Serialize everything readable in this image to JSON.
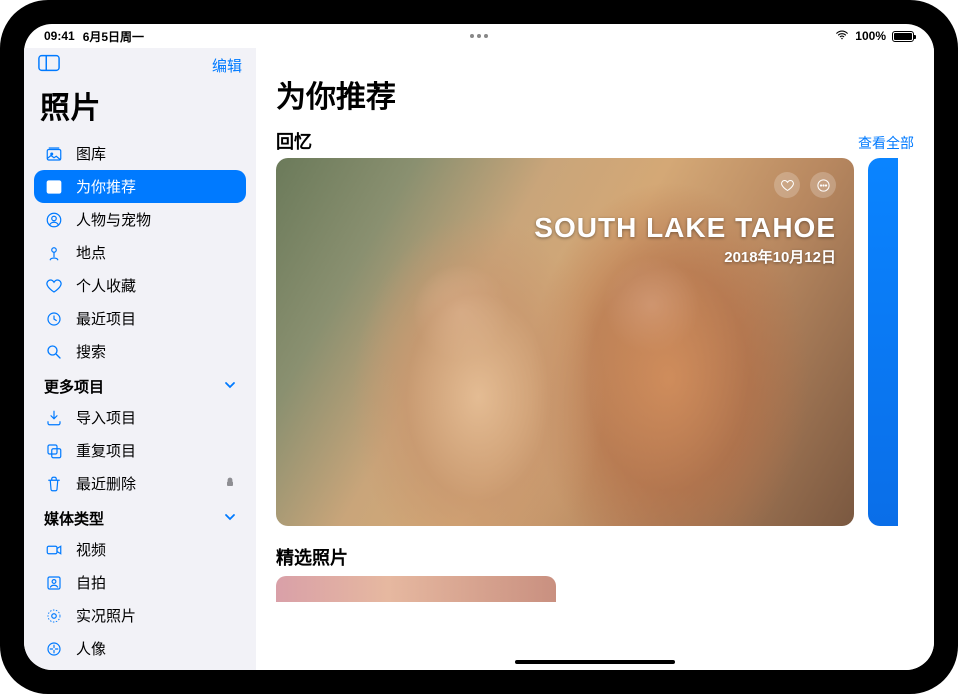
{
  "status": {
    "time": "09:41",
    "date": "6月5日周一",
    "battery_pct": "100%"
  },
  "sidebar": {
    "edit_label": "编辑",
    "title": "照片",
    "items": [
      {
        "label": "图库"
      },
      {
        "label": "为你推荐"
      },
      {
        "label": "人物与宠物"
      },
      {
        "label": "地点"
      },
      {
        "label": "个人收藏"
      },
      {
        "label": "最近项目"
      },
      {
        "label": "搜索"
      }
    ],
    "section_more": "更多项目",
    "more_items": [
      {
        "label": "导入项目"
      },
      {
        "label": "重复项目"
      },
      {
        "label": "最近删除"
      }
    ],
    "section_media": "媒体类型",
    "media_items": [
      {
        "label": "视频"
      },
      {
        "label": "自拍"
      },
      {
        "label": "实况照片"
      },
      {
        "label": "人像"
      }
    ]
  },
  "main": {
    "page_title": "为你推荐",
    "memories_label": "回忆",
    "see_all_label": "查看全部",
    "memory": {
      "title": "SOUTH LAKE TAHOE",
      "date": "2018年10月12日"
    },
    "featured_label": "精选照片"
  }
}
